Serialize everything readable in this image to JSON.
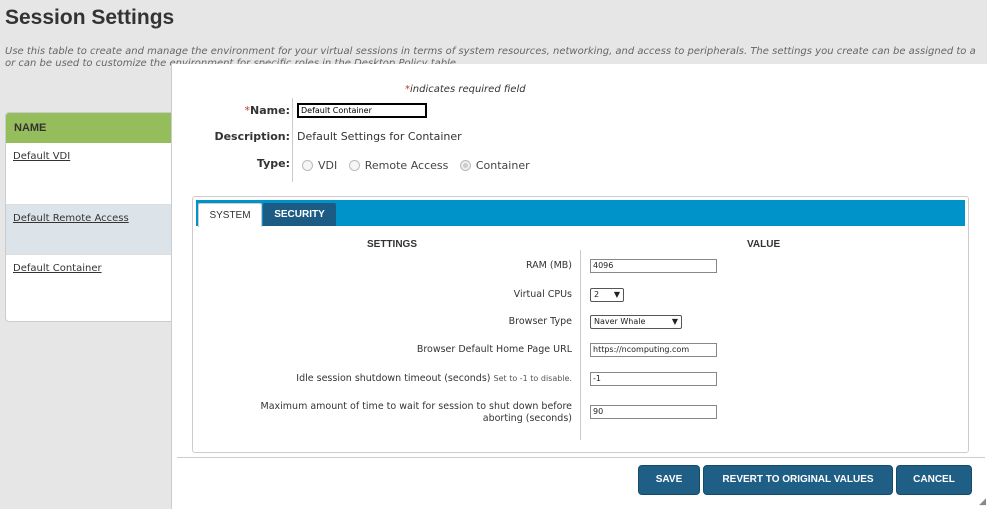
{
  "page": {
    "title": "Session Settings",
    "description": "Use this table to create and manage the environment for your virtual sessions in terms of system resources, networking, and access to peripherals. The settings you create can be assigned to a\nor can be used to customize the environment for specific roles in the Desktop Policy table."
  },
  "list": {
    "header": "NAME",
    "rows": [
      "Default VDI",
      "Default Remote Access",
      "Default Container"
    ]
  },
  "modal": {
    "required_note": "indicates required field",
    "required_star": "*",
    "name_label": "Name:",
    "name_value": "Default Container",
    "description_label": "Description:",
    "description_value": "Default Settings for Container",
    "type_label": "Type:",
    "type_options": [
      "VDI",
      "Remote Access",
      "Container"
    ],
    "type_selected": "Container",
    "tabs": [
      "SYSTEM",
      "SECURITY"
    ],
    "active_tab": "SYSTEM",
    "settings_header": "SETTINGS",
    "value_header": "VALUE",
    "settings": {
      "ram_label": "RAM (MB)",
      "ram_value": "4096",
      "cpus_label": "Virtual CPUs",
      "cpus_value": "2",
      "browser_type_label": "Browser Type",
      "browser_type_value": "Naver Whale",
      "home_page_label": "Browser Default Home Page URL",
      "home_page_value": "https://ncomputing.com",
      "idle_label": "Idle session shutdown timeout (seconds)",
      "idle_hint": "Set to -1 to disable.",
      "idle_value": "-1",
      "max_wait_label": "Maximum amount of time to wait for session to shut down before aborting (seconds)",
      "max_wait_value": "90"
    },
    "buttons": {
      "save": "SAVE",
      "revert": "REVERT TO ORIGINAL VALUES",
      "cancel": "CANCEL"
    }
  },
  "colors": {
    "list_header_bg": "#95bd5c",
    "tab_bar_bg": "#0093c9",
    "button_bg": "#1f5f86",
    "required_star": "#c0392b"
  }
}
